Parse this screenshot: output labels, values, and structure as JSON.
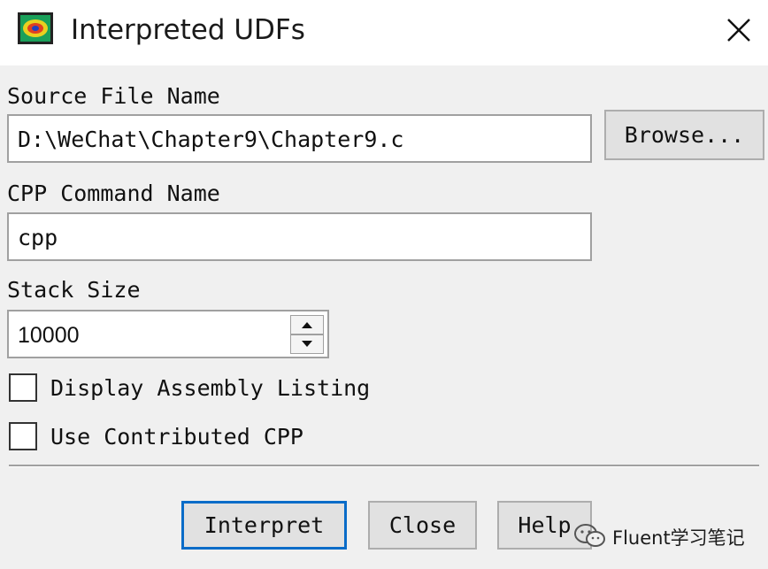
{
  "window": {
    "title": "Interpreted UDFs",
    "icon": "fluent-app-icon",
    "close_icon": "close-icon"
  },
  "source_file": {
    "label": "Source File Name",
    "value": "D:\\WeChat\\Chapter9\\Chapter9.c",
    "browse_label": "Browse..."
  },
  "cpp_command": {
    "label": "CPP Command Name",
    "value": "cpp"
  },
  "stack_size": {
    "label": "Stack Size",
    "value": "10000"
  },
  "options": {
    "display_assembly_listing": {
      "label": "Display Assembly Listing",
      "checked": false
    },
    "use_contributed_cpp": {
      "label": "Use Contributed CPP",
      "checked": false
    }
  },
  "buttons": {
    "interpret": "Interpret",
    "close": "Close",
    "help": "Help"
  },
  "watermark": {
    "text": "Fluent学习笔记",
    "icon": "wechat-icon"
  },
  "colors": {
    "default_button_border": "#0a6cc8",
    "background": "#f0f0f0"
  }
}
